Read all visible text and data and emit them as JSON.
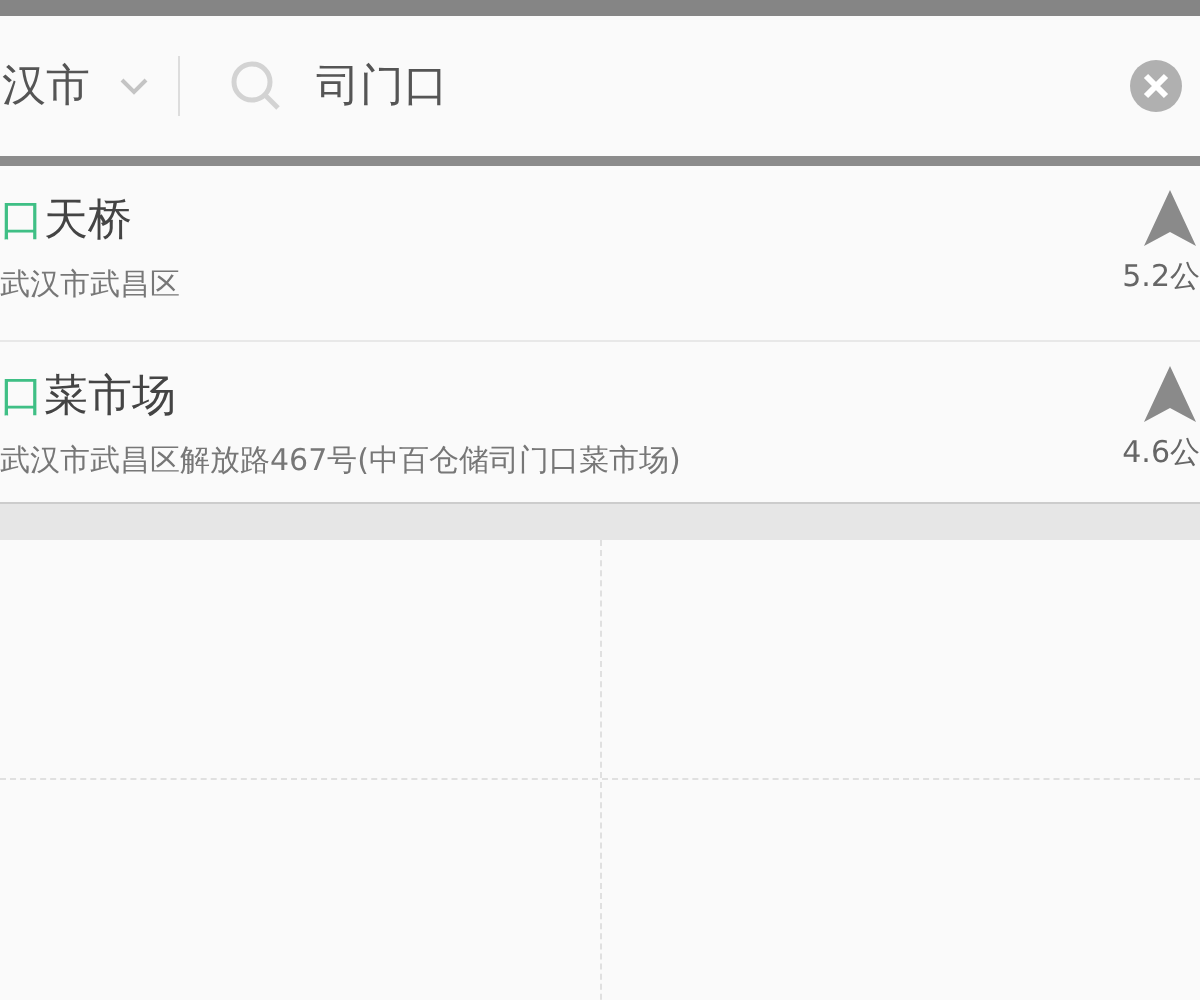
{
  "search_bar": {
    "city": "汉市",
    "query": "司门口"
  },
  "results": [
    {
      "match": "口",
      "rest": "天桥",
      "address": "武汉市武昌区",
      "distance": "5.2公"
    },
    {
      "match": "口",
      "rest": "菜市场",
      "address": "武汉市武昌区解放路467号(中百仓储司门口菜市场)",
      "distance": "4.6公"
    }
  ]
}
